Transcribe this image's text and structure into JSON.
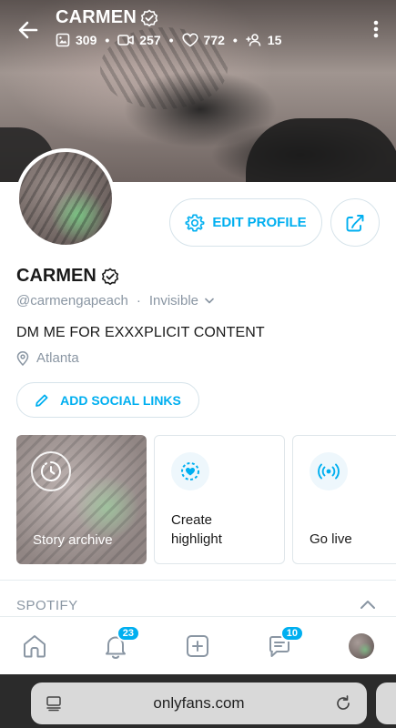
{
  "header": {
    "title": "CARMEN",
    "stats": {
      "photos": "309",
      "videos": "257",
      "likes": "772",
      "subscribers": "15"
    }
  },
  "actions": {
    "edit_profile": "EDIT PROFILE"
  },
  "profile": {
    "name": "CARMEN",
    "handle": "@carmengapeach",
    "separator": "·",
    "status": "Invisible",
    "bio": "DM ME FOR EXXXPLICIT CONTENT",
    "location": "Atlanta",
    "add_social_links": "ADD SOCIAL LINKS"
  },
  "cards": {
    "story_archive": "Story archive",
    "create_highlight": "Create highlight",
    "go_live": "Go live"
  },
  "sections": {
    "spotify": "SPOTIFY"
  },
  "bottom_nav": {
    "notifications_badge": "23",
    "messages_badge": "10"
  },
  "browser": {
    "url": "onlyfans.com"
  },
  "colors": {
    "accent": "#00aff0",
    "muted": "#8a96a3"
  }
}
